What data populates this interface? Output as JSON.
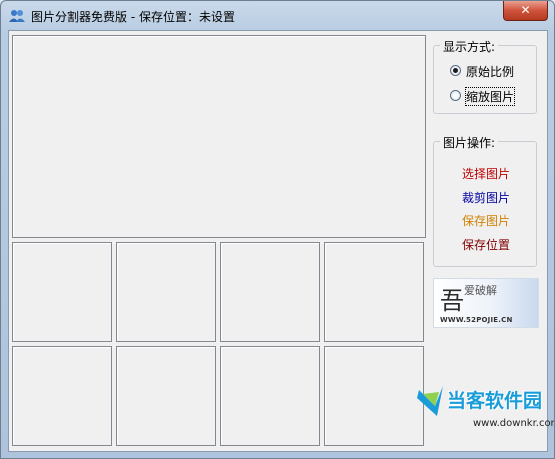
{
  "window": {
    "title": "图片分割器免费版 - 保存位置：未设置",
    "close_symbol": "✕"
  },
  "display_mode": {
    "title": "显示方式:",
    "options": [
      {
        "label": "原始比例",
        "selected": true
      },
      {
        "label": "缩放图片",
        "selected": false
      }
    ]
  },
  "operations": {
    "title": "图片操作:",
    "items": [
      {
        "label": "选择图片",
        "color": "#c00000"
      },
      {
        "label": "裁剪图片",
        "color": "#0000a0"
      },
      {
        "label": "保存图片",
        "color": "#d08000"
      },
      {
        "label": "保存位置",
        "color": "#800000"
      }
    ]
  },
  "logo": {
    "big": "吾",
    "small": "爱破解",
    "url": "WWW.52POJIE.CN"
  },
  "watermark": {
    "name": "当客软件园",
    "url": "www.downkr.com"
  },
  "icons": {
    "app": "users-icon",
    "close": "close-icon"
  }
}
